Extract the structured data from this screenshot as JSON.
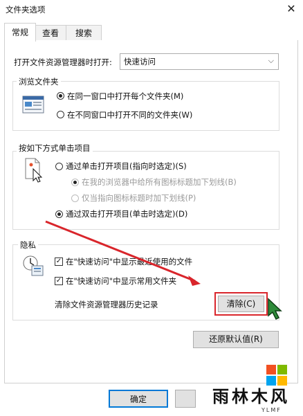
{
  "window": {
    "title": "文件夹选项",
    "close_glyph": "✕"
  },
  "tabs": [
    {
      "label": "常规",
      "active": true
    },
    {
      "label": "查看",
      "active": false
    },
    {
      "label": "搜索",
      "active": false
    }
  ],
  "open_explorer": {
    "label": "打开文件资源管理器时打开:",
    "selected": "快速访问"
  },
  "browse": {
    "legend": "浏览文件夹",
    "options": [
      {
        "label": "在同一窗口中打开每个文件夹(M)",
        "checked": true
      },
      {
        "label": "在不同窗口中打开不同的文件夹(W)",
        "checked": false
      }
    ]
  },
  "click": {
    "legend": "按如下方式单击项目",
    "single": {
      "label": "通过单击打开项目(指向时选定)(S)",
      "checked": false
    },
    "sub_options": [
      {
        "label": "在我的浏览器中给所有图标标题加下划线(B)",
        "checked": true,
        "enabled": false
      },
      {
        "label": "仅当指向图标标题时加下划线(P)",
        "checked": false,
        "enabled": false
      }
    ],
    "double": {
      "label": "通过双击打开项目(单击时选定)(D)",
      "checked": true
    }
  },
  "privacy": {
    "legend": "隐私",
    "recent_files": {
      "label": "在\"快速访问\"中显示最近使用的文件",
      "checked": true
    },
    "frequent_folders": {
      "label": "在\"快速访问\"中显示常用文件夹",
      "checked": true
    },
    "clear_label": "清除文件资源管理器历史记录",
    "clear_button": "清除(C)"
  },
  "restore_button": "还原默认值(R)",
  "footer": {
    "ok": "确定"
  },
  "watermark": {
    "text": "雨林木风",
    "sub": "YLMF"
  },
  "colors": {
    "highlight_red": "#d9252b",
    "accent_blue": "#0078d7"
  }
}
